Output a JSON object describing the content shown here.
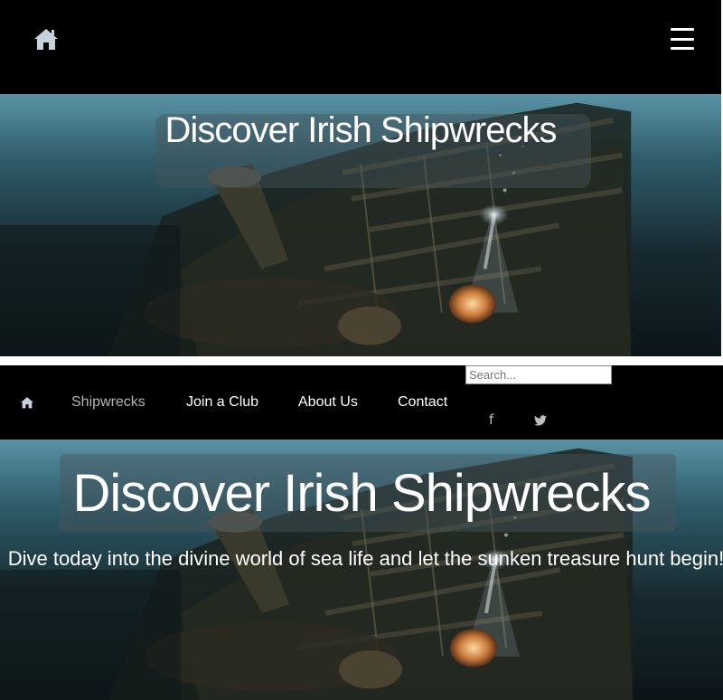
{
  "mobile": {
    "title": "Discover Irish Shipwrecks"
  },
  "nav": {
    "links": [
      {
        "label": "Shipwrecks"
      },
      {
        "label": "Join a Club"
      },
      {
        "label": "About Us"
      },
      {
        "label": "Contact"
      }
    ],
    "search_placeholder": "Search...",
    "social": [
      {
        "icon": "facebook-icon",
        "glyph": "f"
      },
      {
        "icon": "twitter-icon",
        "glyph": "🐦"
      }
    ]
  },
  "hero": {
    "title": "Discover Irish Shipwrecks",
    "tagline": "Dive today into the divine world of sea life and let the sunken treasure hunt begin!"
  },
  "colors": {
    "bar": "#000000",
    "active_link": "#b5b5b5",
    "water_top": "#3a6f80",
    "water_deep": "#0d1a1e"
  }
}
